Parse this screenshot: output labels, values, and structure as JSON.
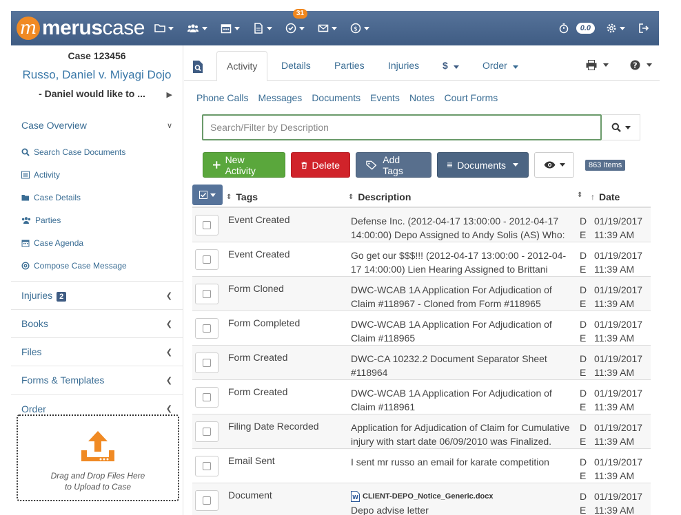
{
  "brand": {
    "logo_mark": "m",
    "name_bold": "merus",
    "name_light": "case"
  },
  "nav": {
    "tasks_badge": "31",
    "timer_value": "0.0"
  },
  "case": {
    "number": "Case 123456",
    "title": "Russo, Daniel v. Miyagi Dojo",
    "subtitle": "- Daniel would like to ..."
  },
  "sidebar": {
    "overview_label": "Case Overview",
    "items": [
      {
        "label": "Search Case Documents",
        "icon": "search-icon"
      },
      {
        "label": "Activity",
        "icon": "list-icon"
      },
      {
        "label": "Case Details",
        "icon": "folder-icon"
      },
      {
        "label": "Parties",
        "icon": "users-icon"
      },
      {
        "label": "Case Agenda",
        "icon": "calendar-icon"
      },
      {
        "label": "Compose Case Message",
        "icon": "at-icon"
      }
    ],
    "sections": [
      {
        "label": "Injuries",
        "count": "2"
      },
      {
        "label": "Books"
      },
      {
        "label": "Files"
      },
      {
        "label": "Forms & Templates"
      },
      {
        "label": "Order"
      }
    ],
    "dropzone": {
      "line1": "Drag and Drop Files Here",
      "line2": "to Upload to Case"
    }
  },
  "tabs": {
    "activity": "Activity",
    "details": "Details",
    "parties": "Parties",
    "injuries": "Injuries",
    "billing": "$",
    "order": "Order"
  },
  "subtabs": [
    "Phone Calls",
    "Messages",
    "Documents",
    "Events",
    "Notes",
    "Court Forms"
  ],
  "search": {
    "placeholder": "Search/Filter by Description",
    "value": ""
  },
  "actions": {
    "new_activity": "New Activity",
    "delete": "Delete",
    "add_tags": "Add Tags",
    "documents": "Documents",
    "items_count": "863 Items"
  },
  "table": {
    "headers": {
      "tags": "Tags",
      "description": "Description",
      "date": "Date"
    },
    "rows": [
      {
        "tag": "Event Created",
        "desc": "Defense Inc. (2012-04-17 13:00:00 - 2012-04-17 14:00:00) Depo Assigned to Andy Solis (AS) Who:",
        "d1": "D",
        "d2": "E",
        "date": "01/19/2017",
        "time": "11:39 AM"
      },
      {
        "tag": "Event Created",
        "desc": "Go get our $$$!!! (2012-04-17 13:00:00 - 2012-04-17 14:00:00) Lien Hearing Assigned to Brittani",
        "d1": "D",
        "d2": "E",
        "date": "01/19/2017",
        "time": "11:39 AM"
      },
      {
        "tag": "Form Cloned",
        "desc": "DWC-WCAB 1A Application For Adjudication of Claim #118967 - Cloned from Form #118965",
        "d1": "D",
        "d2": "E",
        "date": "01/19/2017",
        "time": "11:39 AM"
      },
      {
        "tag": "Form Completed",
        "desc": "DWC-WCAB 1A Application For Adjudication of Claim #118965",
        "d1": "D",
        "d2": "E",
        "date": "01/19/2017",
        "time": "11:39 AM"
      },
      {
        "tag": "Form Created",
        "desc": "DWC-CA 10232.2 Document Separator Sheet #118964",
        "d1": "D",
        "d2": "E",
        "date": "01/19/2017",
        "time": "11:39 AM"
      },
      {
        "tag": "Form Created",
        "desc": "DWC-WCAB 1A Application For Adjudication of Claim #118961",
        "d1": "D",
        "d2": "E",
        "date": "01/19/2017",
        "time": "11:39 AM"
      },
      {
        "tag": "Filing Date Recorded",
        "desc": "Application for Adjudication of Claim for Cumulative injury with start date 06/09/2010 was Finalized.",
        "d1": "D",
        "d2": "E",
        "date": "01/19/2017",
        "time": "11:39 AM"
      },
      {
        "tag": "Email Sent",
        "desc": "I sent mr russo an email for karate competition",
        "d1": "D",
        "d2": "E",
        "date": "01/19/2017",
        "time": "11:39 AM"
      },
      {
        "tag": "Document",
        "doc_name": "CLIENT-DEPO_Notice_Generic.docx",
        "desc": "Depo advise letter",
        "d1": "D",
        "d2": "E",
        "date": "01/19/2017",
        "time": "11:39 AM"
      }
    ]
  },
  "colors": {
    "nav": "#4a678f",
    "accent_orange": "#f08a24",
    "link": "#3a6d94",
    "green": "#5aa73c",
    "red": "#d0232a"
  }
}
